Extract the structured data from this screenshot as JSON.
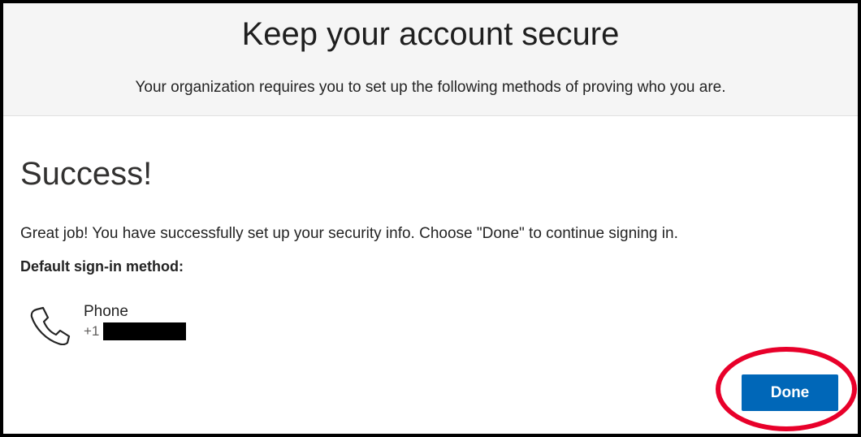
{
  "header": {
    "title": "Keep your account secure",
    "subtitle": "Your organization requires you to set up the following methods of proving who you are."
  },
  "main": {
    "heading": "Success!",
    "message": "Great job! You have successfully set up your security info. Choose \"Done\" to continue signing in.",
    "default_method_label": "Default sign-in method:",
    "method": {
      "icon": "phone-icon",
      "name": "Phone",
      "number_prefix": "+1"
    },
    "done_label": "Done"
  },
  "colors": {
    "accent": "#0067b8",
    "annotation": "#e8002a",
    "header_bg": "#f5f5f5"
  }
}
